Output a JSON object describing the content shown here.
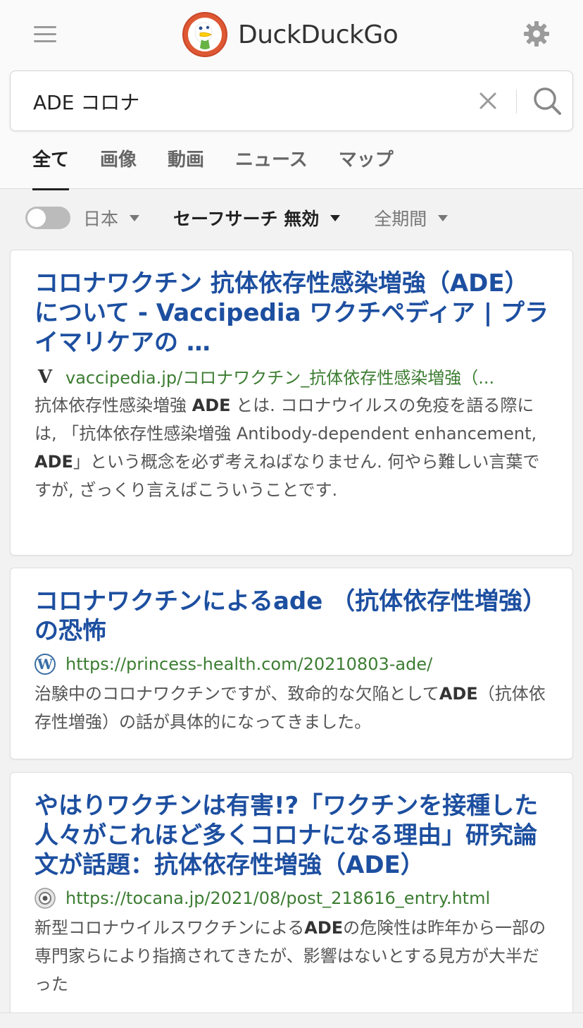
{
  "header": {
    "brand": "DuckDuckGo"
  },
  "search": {
    "query": "ADE コロナ",
    "placeholder": ""
  },
  "tabs": [
    {
      "label": "全て",
      "active": true
    },
    {
      "label": "画像"
    },
    {
      "label": "動画"
    },
    {
      "label": "ニュース"
    },
    {
      "label": "マップ"
    }
  ],
  "filters": {
    "region": "日本",
    "safesearch": "セーフサーチ 無効",
    "time": "全期間"
  },
  "results": [
    {
      "title": "コロナワクチン 抗体依存性感染増強（ADE）について - Vaccipedia ワクチペディア | プライマリケアの …",
      "url": "vaccipedia.jp/コロナワクチン_抗体依存性感染増強（...",
      "favicon": "V",
      "snippet": [
        "抗体依存性感染増強 ",
        "ADE",
        " とは. コロナウイルスの免疫を語る際には, 「抗体依存性感染増強 Antibody-dependent enhancement, ",
        "ADE",
        "」という概念を必ず考えねばなりません. 何やら難しい言葉ですが, ざっくり言えばこういうことです."
      ]
    },
    {
      "title": "コロナワクチンによるade （抗体依存性増強）の恐怖",
      "url": "https://princess-health.com/20210803-ade/",
      "favicon": "wordpress",
      "snippet": [
        "治験中のコロナワクチンですが、致命的な欠陥として",
        "ADE",
        "（抗体依存性増強）の話が具体的になってきました。"
      ]
    },
    {
      "title": "やはりワクチンは有害!?「ワクチンを接種した人々がこれほど多くコロナになる理由」研究論文が話題：抗体依存性増強（ADE）",
      "url": "https://tocana.jp/2021/08/post_218616_entry.html",
      "favicon": "tocana",
      "snippet": [
        "新型コロナウイルスワクチンによる",
        "ADE",
        "の危険性は昨年から一部の専門家らにより指摘されてきたが、影響はないとする見方が大半だった"
      ]
    }
  ]
}
